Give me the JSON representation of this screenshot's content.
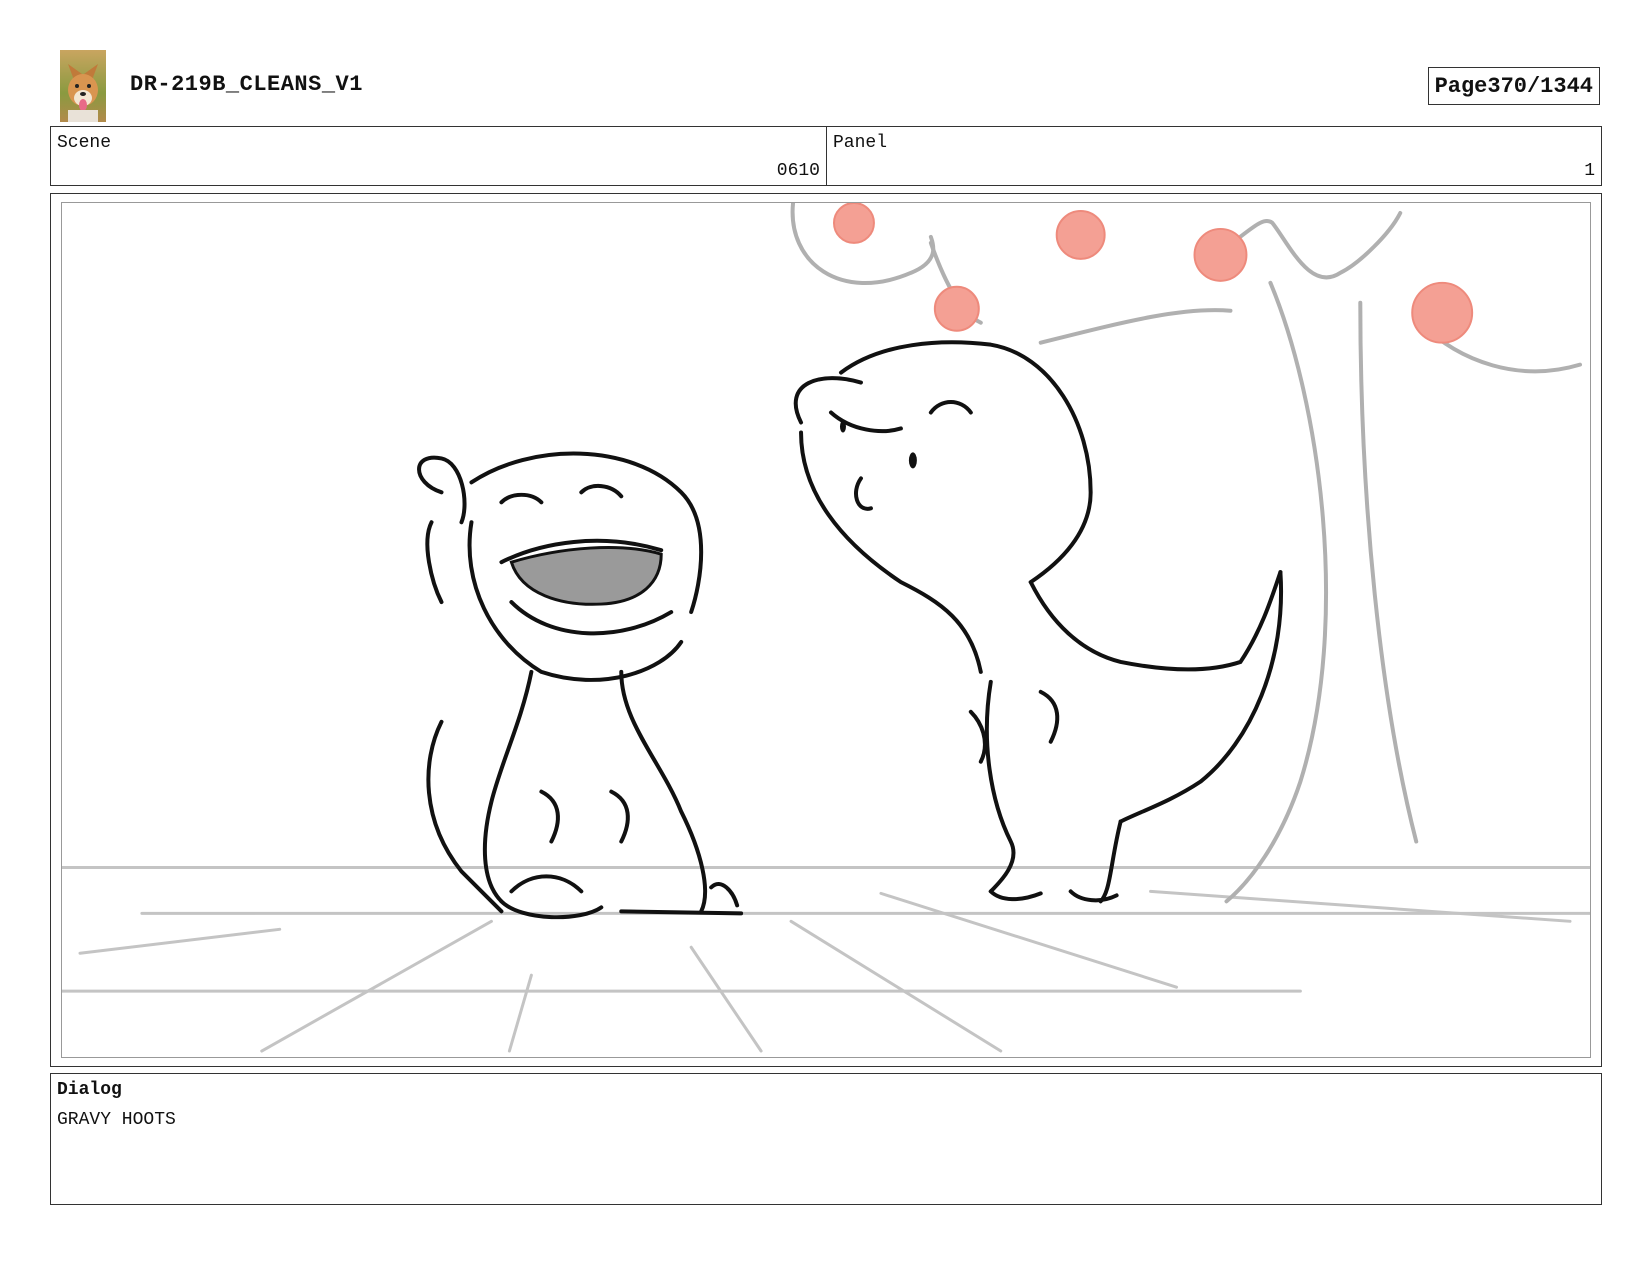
{
  "header": {
    "title": "DR-219B_CLEANS_V1",
    "page_label": "Page",
    "page_number": "370/1344"
  },
  "meta": {
    "scene_label": "Scene",
    "scene_value": "0610",
    "panel_label": "Panel",
    "panel_value": "1"
  },
  "dialog": {
    "label": "Dialog",
    "text": "GRAVY HOOTS"
  },
  "colors": {
    "ink": "#111111",
    "guide": "#b8b8b8",
    "fruit": "#f4a094"
  }
}
